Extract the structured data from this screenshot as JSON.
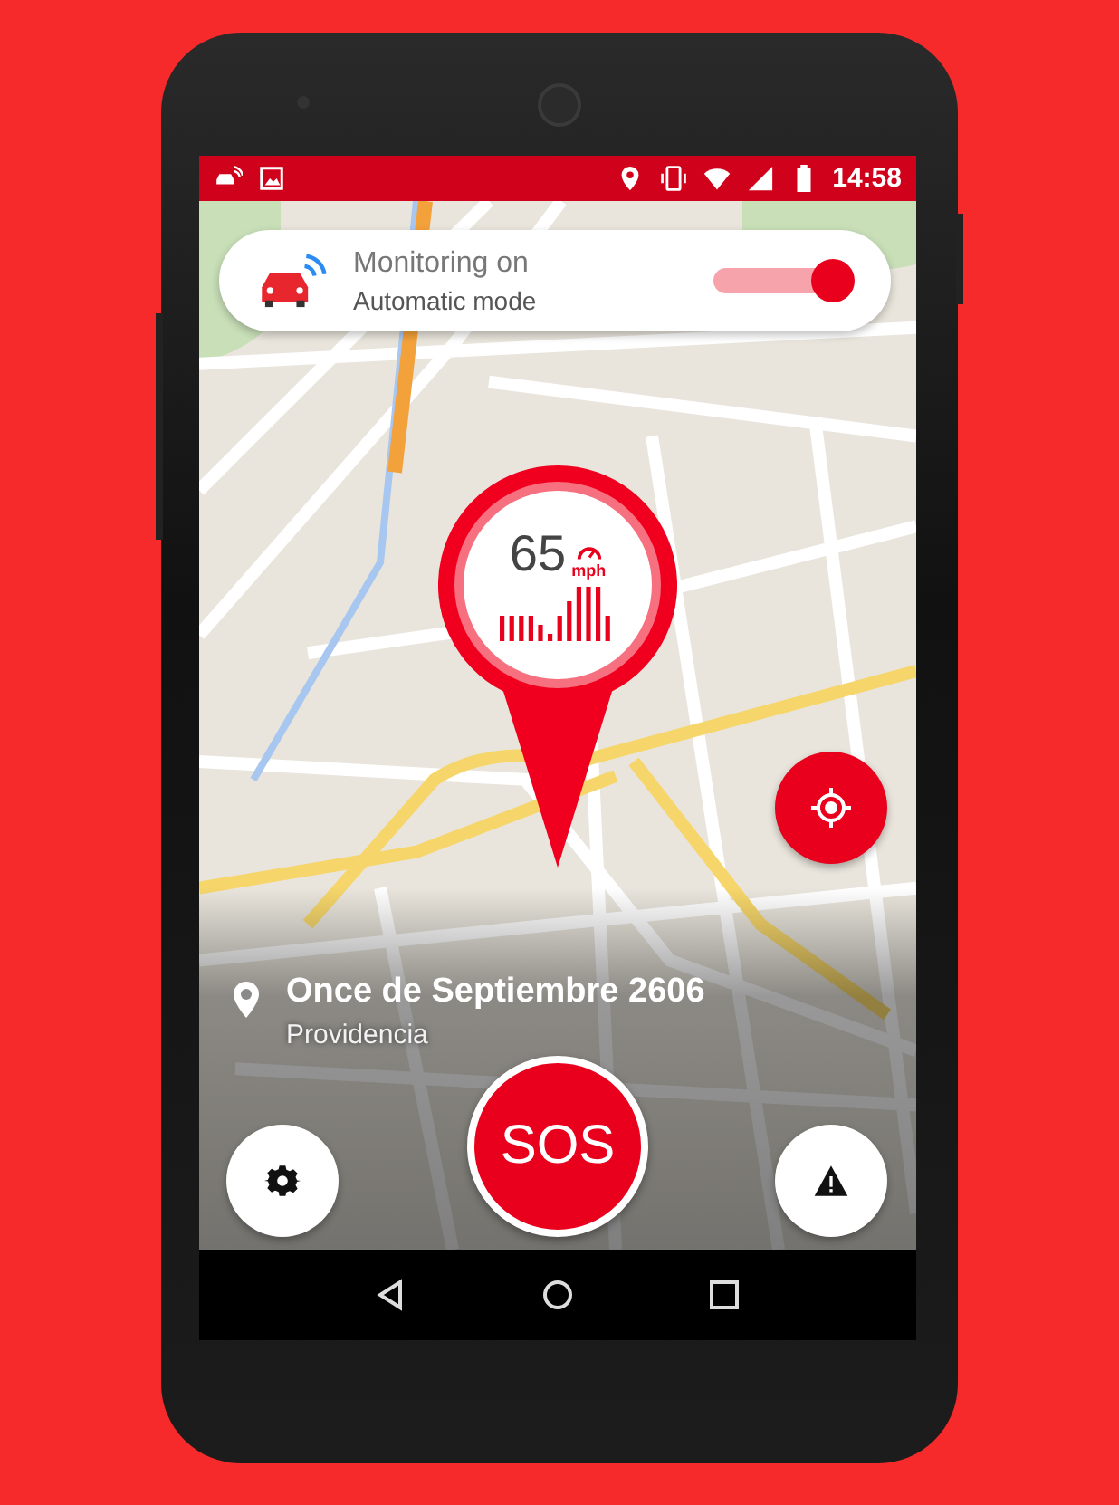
{
  "status_bar": {
    "time": "14:58"
  },
  "monitor_card": {
    "title": "Monitoring on",
    "subtitle": "Automatic mode",
    "toggle_on": true
  },
  "speed_pin": {
    "speed": "65",
    "unit": "mph"
  },
  "address": {
    "street": "Once de Septiembre 2606",
    "area": "Providencia"
  },
  "sos_button": {
    "label": "SOS"
  }
}
